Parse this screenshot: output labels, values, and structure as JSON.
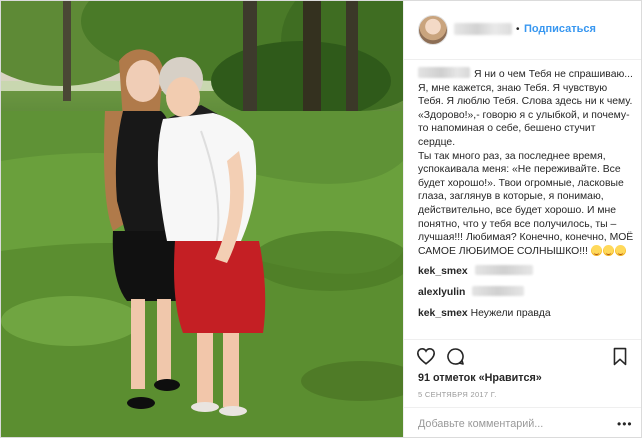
{
  "header": {
    "follow_label": "Подписаться"
  },
  "caption": {
    "paragraph1": "Я ни о чем Тебя не спрашиваю... Я, мне кажется, знаю Тебя. Я чувствую Тебя. Я люблю Тебя. Слова здесь ни к чему. «Здорово!»,- говорю я с улыбкой, и почему-то напоминая о себе, бешено стучит сердце.",
    "paragraph2": "Ты так много раз, за последнее время, успокаивала меня: «Не переживайте. Все будет хорошо!». Твои огромные, ласковые глаза, заглянув в которые, я понимаю, действительно, все будет хорошо. И мне понятно, что у тебя все получилось, ты – лучшая!!! Любимая? Конечно, конечно, МОЁ САМОЕ ЛЮБИМОЕ СОЛНЫШКО!!!"
  },
  "comments": [
    {
      "user": "kek_smex",
      "text": ""
    },
    {
      "user": "alexlyulin",
      "text": ""
    },
    {
      "user": "kek_smex",
      "text": "Неужели правда"
    }
  ],
  "likes_text": "91 отметок «Нравится»",
  "date_text": "5 СЕНТЯБРЯ 2017 Г.",
  "add_comment": {
    "placeholder": "Добавьте комментарий..."
  },
  "icons": [
    "heart-icon",
    "comment-icon",
    "bookmark-icon",
    "more-options-icon"
  ],
  "colors": {
    "link_blue": "#3897f0",
    "text": "#262626",
    "muted": "#999999",
    "divider": "#efefef"
  }
}
